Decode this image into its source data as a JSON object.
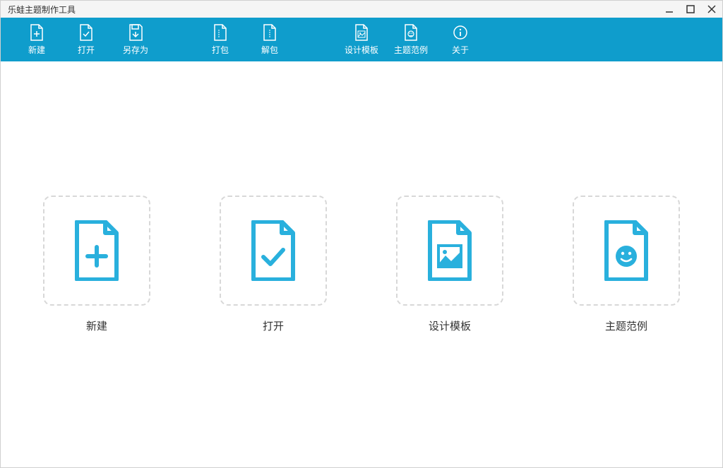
{
  "window": {
    "title": "乐蛙主题制作工具"
  },
  "toolbar": {
    "new": "新建",
    "open": "打开",
    "saveAs": "另存为",
    "pack": "打包",
    "unpack": "解包",
    "designTemplate": "设计模板",
    "themeExample": "主题范例",
    "about": "关于"
  },
  "cards": {
    "new": "新建",
    "open": "打开",
    "designTemplate": "设计模板",
    "themeExample": "主题范例"
  },
  "colors": {
    "accent": "#0f9dcc",
    "iconBlue": "#29b0dd",
    "borderDash": "#d8d8d8"
  }
}
